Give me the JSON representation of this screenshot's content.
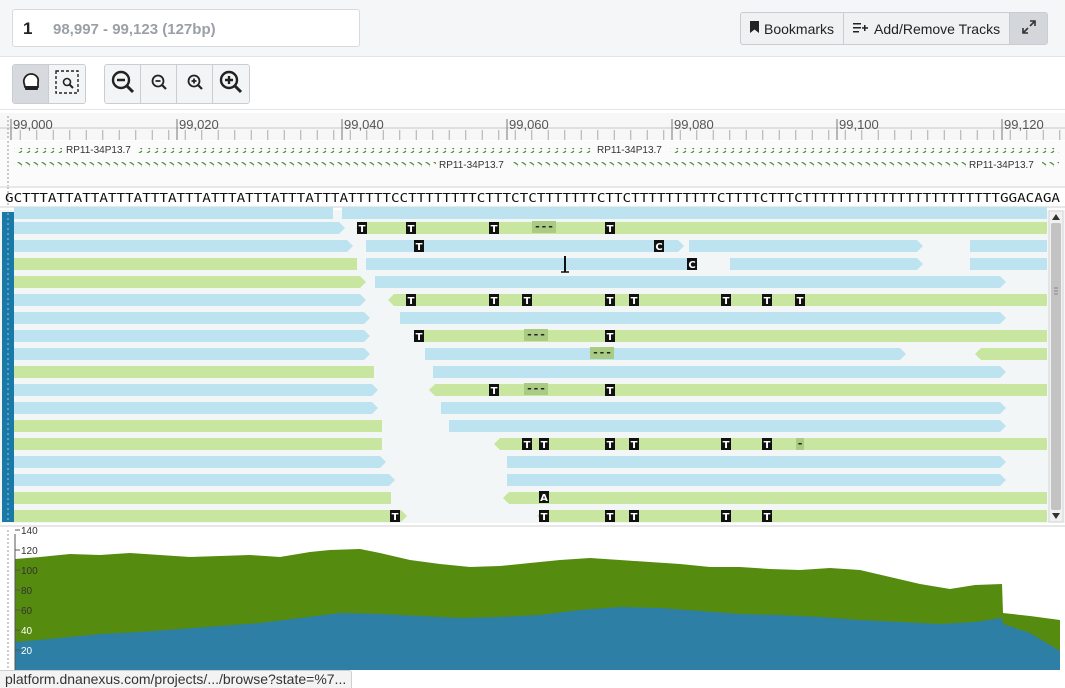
{
  "locus": {
    "chromosome": "1",
    "range": "98,997 - 99,123 (127bp)"
  },
  "header_buttons": {
    "bookmarks": "Bookmarks",
    "add_remove_tracks": "Add/Remove Tracks"
  },
  "toolbar": {
    "tools": [
      "pan-tool",
      "zoom-select-tool"
    ],
    "zoom": [
      "zoom-out-large",
      "zoom-out-small",
      "zoom-in-small",
      "zoom-in-large"
    ]
  },
  "ruler": {
    "ticks": [
      "99,000",
      "99,020",
      "99,040",
      "99,060",
      "99,080",
      "99,100",
      "99,120"
    ]
  },
  "gene_track": {
    "labels": [
      "RP11-34P13.7",
      "RP11-34P13.7",
      "RP11-34P13.7",
      "RP11-34P13.7"
    ]
  },
  "sequence": "GCTTTATTATTATTTATTTATTTATTTATTTATTTATTTATTTTTCCTTTTTTTTCTTTCTCTTTTTTTCTTCTTTTTTTTTTCTTTTCTTTCTTTTTTTTTTTTTTTTTTTTTTTGGACAGA",
  "reads": {
    "mismatch_labels": [
      "T",
      "T",
      "T",
      "---",
      "T",
      "T",
      "C",
      "C",
      "T",
      "T",
      "T",
      "T",
      "T",
      "T",
      "T",
      "T",
      "T",
      "---",
      "T",
      "---",
      "T",
      "---",
      "T",
      "T",
      "T",
      "T",
      "T",
      "T",
      "T",
      "-",
      "A",
      "T",
      "T",
      "T",
      "T",
      "T",
      "T"
    ]
  },
  "coverage": {
    "y_ticks": [
      "140",
      "120",
      "100",
      "80",
      "60",
      "40",
      "20"
    ]
  },
  "status_url": "platform.dnanexus.com/projects/.../browse?state=%7...",
  "colors": {
    "forward_read": "#c8e6a0",
    "reverse_read": "#bde2f0",
    "coverage_total": "#558b0e",
    "coverage_reverse": "#2e7fa6",
    "accent": "#1b79a8"
  }
}
